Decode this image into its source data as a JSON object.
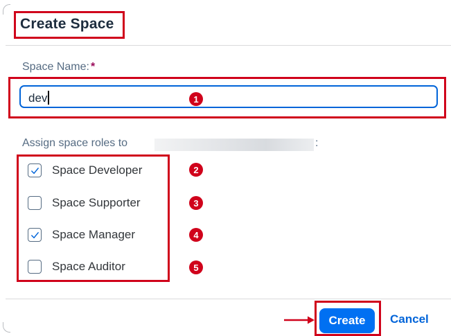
{
  "dialog": {
    "title": "Create Space",
    "space_name": {
      "label": "Space Name:",
      "required_mark": "*",
      "value": "dev"
    },
    "assign_label": "Assign space roles to",
    "assign_suffix": ":",
    "roles": [
      {
        "label": "Space Developer",
        "checked": true,
        "badge": "2"
      },
      {
        "label": "Space Supporter",
        "checked": false,
        "badge": "3"
      },
      {
        "label": "Space Manager",
        "checked": true,
        "badge": "4"
      },
      {
        "label": "Space Auditor",
        "checked": false,
        "badge": "5"
      }
    ],
    "input_badge": "1",
    "footer": {
      "create_label": "Create",
      "cancel_label": "Cancel"
    }
  },
  "colors": {
    "annotation": "#d0021b",
    "emphasized_button": "#0070f2",
    "link": "#0064d9",
    "focus_border": "#0064d9",
    "required": "#9a0b5a"
  },
  "icons": {
    "checkmark": "checkmark-icon",
    "arrow": "red-arrow-icon"
  }
}
